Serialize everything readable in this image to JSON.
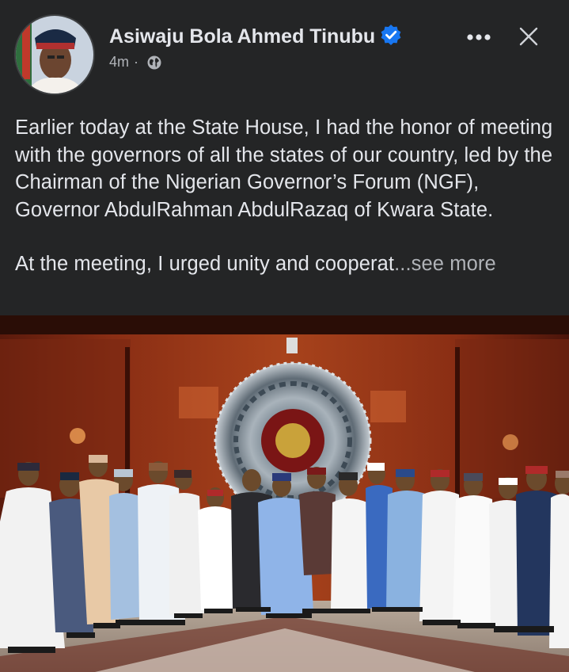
{
  "post": {
    "author": "Asiwaju Bola Ahmed Tinubu",
    "verified": true,
    "timestamp": "4m",
    "separator": "·",
    "audience_icon": "globe-icon",
    "more_icon": "more-options-icon",
    "close_icon": "close-icon",
    "paragraph_1": "Earlier today at the State House, I had the honor of meeting with the governors of all the states of our country, led by the Chairman of the Nigerian Governor’s Forum (NGF), Governor AbdulRahman AbdulRazaq of Kwara State.",
    "paragraph_2": "At the meeting, I urged unity and cooperat",
    "see_more": "...see more"
  },
  "colors": {
    "background": "#242526",
    "text": "#e4e6eb",
    "secondary_text": "#b0b3b8",
    "verified_badge": "#1877f2"
  }
}
